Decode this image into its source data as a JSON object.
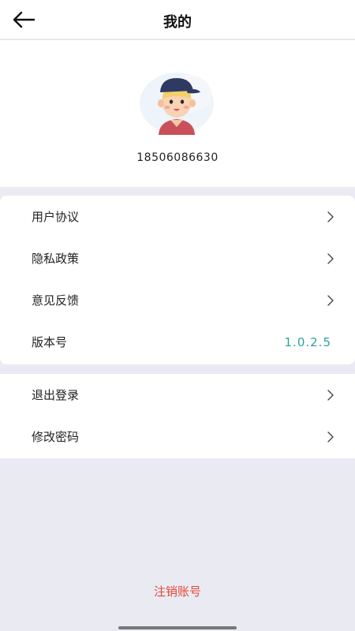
{
  "header": {
    "title": "我的",
    "back_icon": "arrow-left-icon"
  },
  "profile": {
    "avatar_icon": "user-avatar-icon",
    "phone": "18506086630"
  },
  "menu_group_1": [
    {
      "label": "用户协议",
      "icon": "chevron-right-icon"
    },
    {
      "label": "隐私政策",
      "icon": "chevron-right-icon"
    },
    {
      "label": "意见反馈",
      "icon": "chevron-right-icon"
    },
    {
      "label": "版本号",
      "value": "1.0.2.5"
    }
  ],
  "menu_group_2": [
    {
      "label": "退出登录",
      "icon": "chevron-right-icon"
    },
    {
      "label": "修改密码",
      "icon": "chevron-right-icon"
    }
  ],
  "footer": {
    "deregister_label": "注销账号"
  },
  "colors": {
    "background": "#eaebf2",
    "version_value": "#2aa39a",
    "deregister": "#e5463a"
  }
}
